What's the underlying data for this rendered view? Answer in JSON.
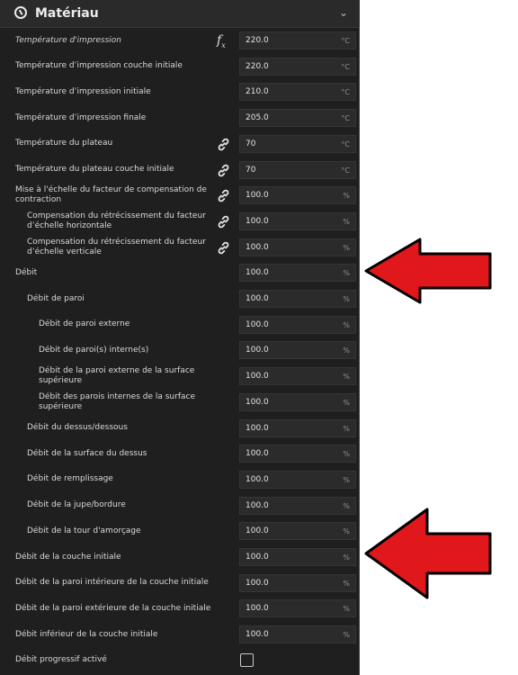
{
  "section": {
    "title": "Matériau"
  },
  "rows": [
    {
      "label": "Température d'impression",
      "value": "220.0",
      "unit": "°C",
      "style": "italic",
      "level": 1,
      "icon": "function-icon"
    },
    {
      "label": "Température d’impression couche initiale",
      "value": "220.0",
      "unit": "°C",
      "level": 1
    },
    {
      "label": "Température d’impression initiale",
      "value": "210.0",
      "unit": "°C",
      "level": 1
    },
    {
      "label": "Température d’impression finale",
      "value": "205.0",
      "unit": "°C",
      "level": 1
    },
    {
      "label": "Température du plateau",
      "value": "70",
      "unit": "°C",
      "level": 1,
      "icon": "link-icon"
    },
    {
      "label": "Température du plateau couche initiale",
      "value": "70",
      "unit": "°C",
      "level": 1,
      "icon": "link-icon"
    },
    {
      "label": "Mise à l'échelle du facteur de compensation de contraction",
      "value": "100.0",
      "unit": "%",
      "level": 1,
      "icon": "link-icon"
    },
    {
      "label": "Compensation du rétrécissement du facteur d’échelle horizontale",
      "value": "100.0",
      "unit": "%",
      "level": 2,
      "icon": "link-icon"
    },
    {
      "label": "Compensation du rétrécissement du facteur d’échelle verticale",
      "value": "100.0",
      "unit": "%",
      "level": 2,
      "icon": "link-icon"
    },
    {
      "label": "Débit",
      "value": "100.0",
      "unit": "%",
      "level": 1
    },
    {
      "label": "Débit de paroi",
      "value": "100.0",
      "unit": "%",
      "level": 2
    },
    {
      "label": "Débit de paroi externe",
      "value": "100.0",
      "unit": "%",
      "level": 3
    },
    {
      "label": "Débit de paroi(s) interne(s)",
      "value": "100.0",
      "unit": "%",
      "level": 3
    },
    {
      "label": "Débit de la paroi externe de la surface supérieure",
      "value": "100.0",
      "unit": "%",
      "level": 3
    },
    {
      "label": "Débit des parois internes de la surface supérieure",
      "value": "100.0",
      "unit": "%",
      "level": 3
    },
    {
      "label": "Débit du dessus/dessous",
      "value": "100.0",
      "unit": "%",
      "level": 2
    },
    {
      "label": "Débit de la surface du dessus",
      "value": "100.0",
      "unit": "%",
      "level": 2
    },
    {
      "label": "Débit de remplissage",
      "value": "100.0",
      "unit": "%",
      "level": 2
    },
    {
      "label": "Débit de la jupe/bordure",
      "value": "100.0",
      "unit": "%",
      "level": 2
    },
    {
      "label": "Débit de la tour d'amorçage",
      "value": "100.0",
      "unit": "%",
      "level": 2
    },
    {
      "label": "Débit de la couche initiale",
      "value": "100.0",
      "unit": "%",
      "level": 1
    },
    {
      "label": "Débit de la paroi intérieure de la couche initiale",
      "value": "100.0",
      "unit": "%",
      "level": 1
    },
    {
      "label": "Débit de la paroi extérieure de la couche initiale",
      "value": "100.0",
      "unit": "%",
      "level": 1
    },
    {
      "label": "Débit inférieur de la couche initiale",
      "value": "100.0",
      "unit": "%",
      "level": 1
    },
    {
      "label": "Débit progressif activé",
      "type": "checkbox",
      "checked": false,
      "level": 1
    }
  ],
  "annotations": [
    {
      "name": "red-arrow-debit",
      "color": "#e0181b"
    },
    {
      "name": "red-arrow-debit-couche-initiale",
      "color": "#e0181b"
    }
  ]
}
